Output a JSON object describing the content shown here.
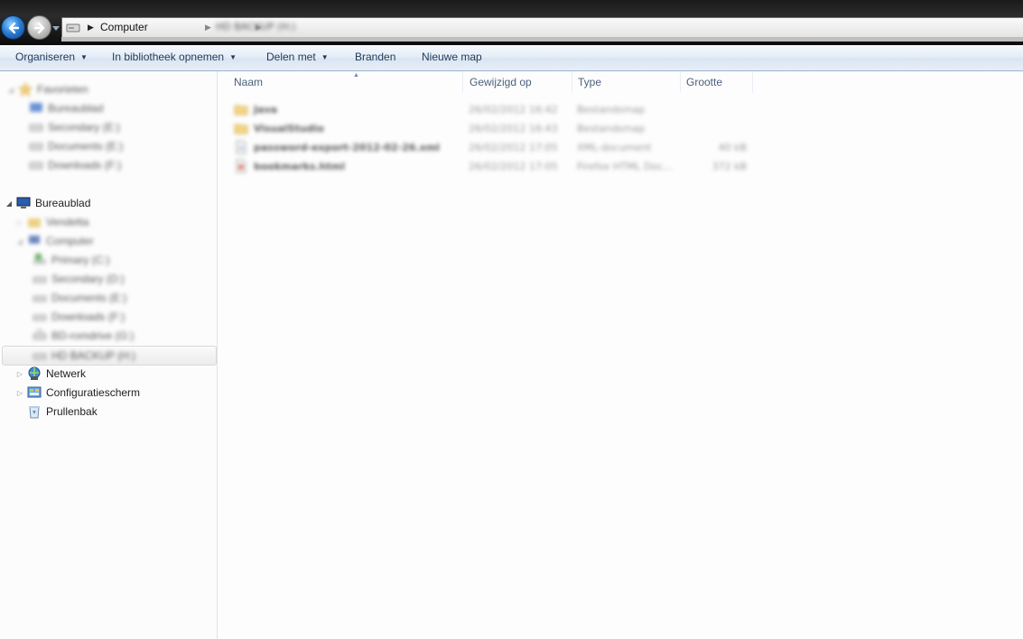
{
  "window": {
    "address": {
      "crumb": "Computer",
      "current_blurred": "HD BACKUP (H:)"
    }
  },
  "toolbar": {
    "organize": "Organiseren",
    "library": "In bibliotheek opnemen",
    "share": "Delen met",
    "burn": "Branden",
    "new_folder": "Nieuwe map"
  },
  "nav": {
    "favorites_header": "Favorieten",
    "favorites": [
      "Bureaublad",
      "Secondary (E:)",
      "Documents (E:)",
      "Downloads (F:)"
    ],
    "desktop": "Bureaublad",
    "desktop_children": {
      "user": "Vendetta",
      "computer": "Computer",
      "drives": [
        "Primary (C:)",
        "Secondary (D:)",
        "Documents (E:)",
        "Downloads (F:)",
        "BD-romdrive (G:)",
        "HD BACKUP (H:)"
      ]
    },
    "network": "Netwerk",
    "control_panel": "Configuratiescherm",
    "recycle_bin": "Prullenbak"
  },
  "columns": {
    "name": "Naam",
    "modified": "Gewijzigd op",
    "type": "Type",
    "size": "Grootte"
  },
  "files": [
    {
      "name": "Java",
      "modified": "26/02/2012 16:42",
      "type": "Bestandsmap",
      "size": "",
      "icon": "folder-icon"
    },
    {
      "name": "VisualStudio",
      "modified": "26/02/2012 16:43",
      "type": "Bestandsmap",
      "size": "",
      "icon": "folder-icon"
    },
    {
      "name": "password-export-2012-02-26.xml",
      "modified": "26/02/2012 17:05",
      "type": "XML-document",
      "size": "40 kB",
      "icon": "xml-file-icon"
    },
    {
      "name": "bookmarks.html",
      "modified": "26/02/2012 17:05",
      "type": "Firefox HTML Doc...",
      "size": "372 kB",
      "icon": "html-file-icon"
    }
  ],
  "colors": {
    "toolbar_text": "#1e395b",
    "column_header_text": "#4c607a",
    "back_button": "#2b7fd6"
  }
}
